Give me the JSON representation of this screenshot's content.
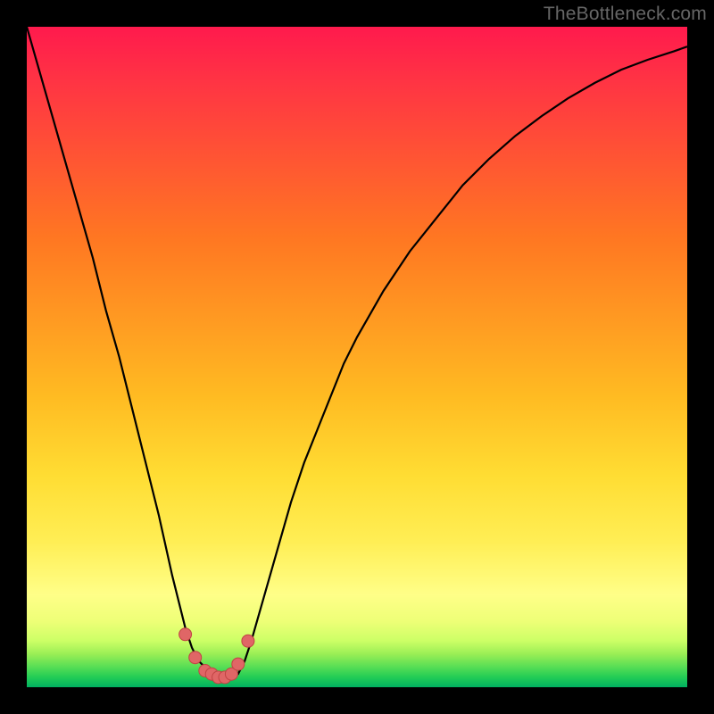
{
  "watermark": "TheBottleneck.com",
  "chart_data": {
    "type": "line",
    "title": "",
    "xlabel": "",
    "ylabel": "",
    "xlim": [
      0,
      100
    ],
    "ylim": [
      0,
      100
    ],
    "grid": false,
    "legend": false,
    "series": [
      {
        "name": "curve",
        "x": [
          0,
          2,
          4,
          6,
          8,
          10,
          12,
          14,
          16,
          18,
          20,
          22,
          24,
          25,
          26,
          27,
          28,
          29,
          30,
          31,
          32,
          33,
          34,
          36,
          38,
          40,
          42,
          44,
          46,
          48,
          50,
          54,
          58,
          62,
          66,
          70,
          74,
          78,
          82,
          86,
          90,
          94,
          98,
          100
        ],
        "y": [
          100,
          93,
          86,
          79,
          72,
          65,
          57,
          50,
          42,
          34,
          26,
          17,
          9,
          6,
          4,
          3,
          2,
          1.5,
          1.3,
          1.5,
          2,
          4,
          7,
          14,
          21,
          28,
          34,
          39,
          44,
          49,
          53,
          60,
          66,
          71,
          76,
          80,
          83.5,
          86.5,
          89.2,
          91.5,
          93.5,
          95,
          96.3,
          97
        ]
      }
    ],
    "markers": {
      "name": "bottom-cluster",
      "x": [
        24,
        25.5,
        27,
        28,
        29,
        30,
        31,
        32,
        33.5
      ],
      "y": [
        8,
        4.5,
        2.5,
        2,
        1.5,
        1.5,
        2,
        3.5,
        7
      ]
    },
    "colors": {
      "curve_stroke": "#000000",
      "marker_fill": "#e06666",
      "gradient_top": "#ff1a4d",
      "gradient_bottom": "#00b060"
    }
  }
}
